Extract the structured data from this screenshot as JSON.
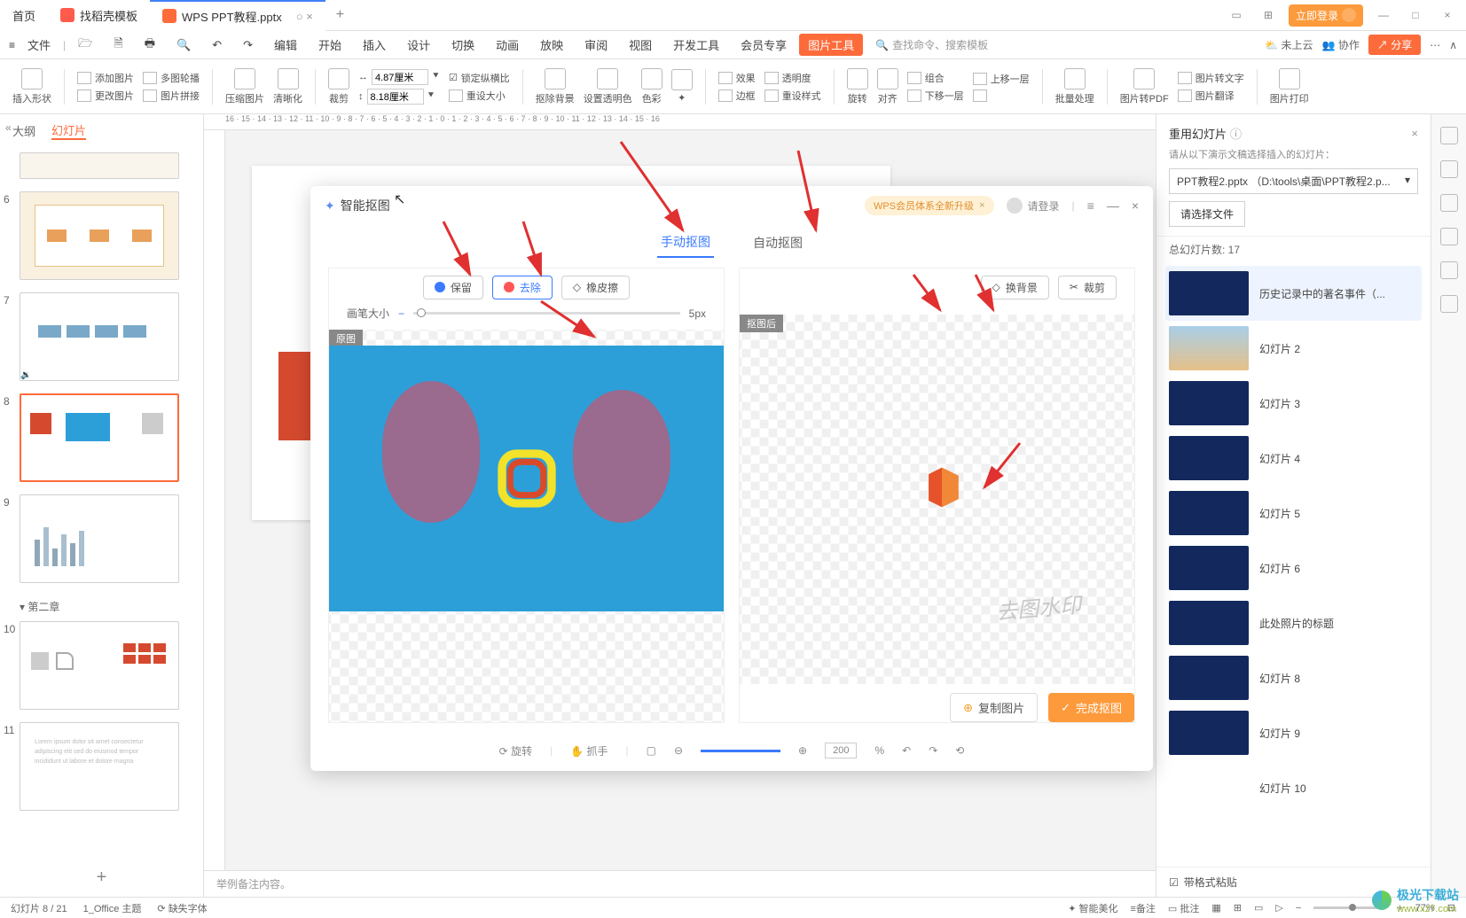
{
  "titlebar": {
    "tabs": [
      {
        "label": "首页",
        "icon_color": "#5b8def"
      },
      {
        "label": "找稻壳模板",
        "icon_color": "#ff5b4c"
      },
      {
        "label": "WPS PPT教程.pptx",
        "icon_color": "#fd6b3b"
      }
    ],
    "login": "立即登录"
  },
  "menubar": {
    "file": "文件",
    "edit": "编辑",
    "items": [
      "开始",
      "插入",
      "设计",
      "切换",
      "动画",
      "放映",
      "审阅",
      "视图",
      "开发工具",
      "会员专享"
    ],
    "pic_tool": "图片工具",
    "search_placeholder": "查找命令、搜索模板",
    "cloud": "未上云",
    "collab": "协作",
    "share": "分享"
  },
  "ribbon": {
    "insert_shape": "插入形状",
    "row1": {
      "a": "添加图片",
      "b": "多图轮播",
      "c": "更改图片",
      "d": "图片拼接"
    },
    "compress": "压缩图片",
    "clarity": "清晰化",
    "crop": "裁剪",
    "dim_w": "4.87厘米",
    "dim_h": "8.18厘米",
    "lock": "锁定纵横比",
    "reset": "重设大小",
    "remove_bg": "抠除背景",
    "transparent": "设置透明色",
    "color": "色彩",
    "effect": "效果",
    "transparency": "透明度",
    "border": "边框",
    "reset_style": "重设样式",
    "rotate": "旋转",
    "align": "对齐",
    "group": "组合",
    "up": "上移一层",
    "down": "下移一层",
    "batch": "批量处理",
    "to_pdf": "图片转PDF",
    "to_text": "图片转文字",
    "translate": "图片翻译",
    "print": "图片打印"
  },
  "left": {
    "tab_outline": "大纲",
    "tab_slides": "幻灯片",
    "section": "第二章",
    "nums": [
      "6",
      "7",
      "8",
      "9",
      "10",
      "11"
    ]
  },
  "ruler": "16 · 15 · 14 · 13 · 12 · 11 · 10 · 9 · 8 · 7 · 6 · 5 · 4 · 3 · 2 · 1 · 0 · 1 · 2 · 3 · 4 · 5 · 6 · 7 · 8 · 9 · 10 · 11 · 12 · 13 · 14 · 15 · 16",
  "notes_placeholder": "举例备注内容。",
  "dialog": {
    "title": "智能抠图",
    "member": "WPS会员体系全新升级",
    "login": "请登录",
    "tab_manual": "手动抠图",
    "tab_auto": "自动抠图",
    "keep": "保留",
    "remove": "去除",
    "eraser": "橡皮擦",
    "brush": "画笔大小",
    "brush_px": "5px",
    "orig_label": "原图",
    "result_label": "抠图后",
    "bg": "换背景",
    "crop": "裁剪",
    "watermark": "去图水印",
    "copy": "复制图片",
    "done": "完成抠图",
    "rotate": "旋转",
    "hand": "抓手",
    "zoom_val": "200",
    "zoom_pct": "%"
  },
  "right": {
    "title": "重用幻灯片",
    "sub": "请从以下演示文稿选择插入的幻灯片：",
    "dd": "PPT教程2.pptx （D:\\tools\\桌面\\PPT教程2.p...",
    "select_file": "请选择文件",
    "total": "总幻灯片数: 17",
    "items": [
      {
        "label": "历史记录中的著名事件（...",
        "sel": true,
        "bg": "#13295e"
      },
      {
        "label": "幻灯片 2",
        "bg": "linear-gradient(180deg,#a9cfe8,#e6c088)"
      },
      {
        "label": "幻灯片 3",
        "bg": "#13295e"
      },
      {
        "label": "幻灯片 4",
        "bg": "#13295e"
      },
      {
        "label": "幻灯片 5",
        "bg": "#13295e"
      },
      {
        "label": "幻灯片 6",
        "bg": "#13295e"
      },
      {
        "label": "此处照片的标题",
        "bg": "#13295e"
      },
      {
        "label": "幻灯片 8",
        "bg": "#13295e"
      },
      {
        "label": "幻灯片 9",
        "bg": "#13295e"
      },
      {
        "label": "幻灯片 10",
        "bg": "#fff"
      }
    ],
    "keep_fmt": "带格式粘贴"
  },
  "status": {
    "page": "幻灯片 8 / 21",
    "theme": "1_Office 主题",
    "missing_font": "缺失字体",
    "beautify": "智能美化",
    "nb": "≡备注",
    "cm": "批注",
    "zoom": "77%"
  },
  "brand": {
    "name": "极光下载站",
    "domain": "www.xz7.com"
  }
}
